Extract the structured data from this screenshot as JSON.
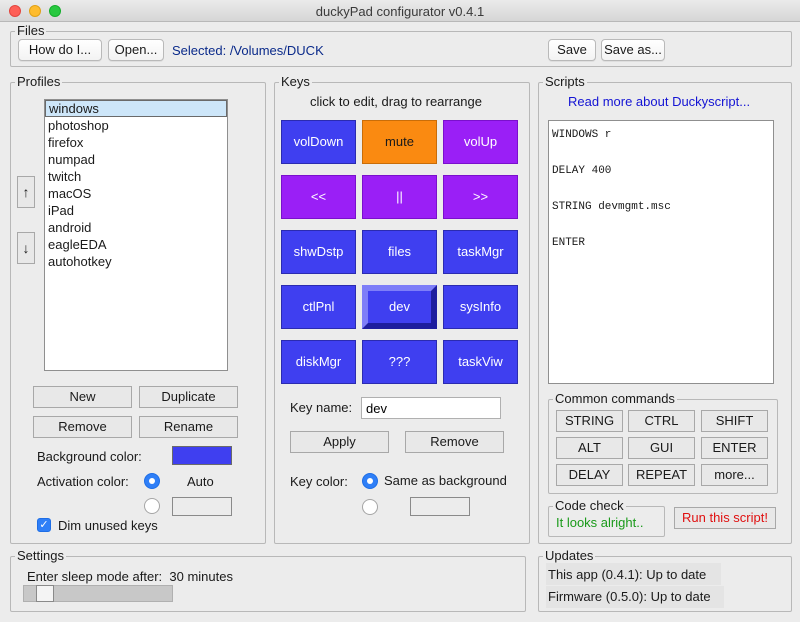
{
  "window": {
    "title": "duckyPad configurator v0.4.1"
  },
  "files": {
    "label": "Files",
    "howdoi_label": "How do I...",
    "open_label": "Open...",
    "selected_text": "Selected: /Volumes/DUCK",
    "save_label": "Save",
    "saveas_label": "Save as..."
  },
  "profiles": {
    "label": "Profiles",
    "items": [
      "windows",
      "photoshop",
      "firefox",
      "numpad",
      "twitch",
      "macOS",
      "iPad",
      "android",
      "eagleEDA",
      "autohotkey"
    ],
    "selected": "windows",
    "up_arrow": "↑",
    "down_arrow": "↓",
    "new_label": "New",
    "duplicate_label": "Duplicate",
    "remove_label": "Remove",
    "rename_label": "Rename",
    "bg_color_label": "Background color:",
    "bg_color": "#3f3ff0",
    "activation_color_label": "Activation color:",
    "auto_label": "Auto",
    "dim_label": "Dim unused keys",
    "dim_checked": true
  },
  "keys": {
    "label": "Keys",
    "hint": "click to edit, drag to rearrange",
    "grid": [
      {
        "label": "volDown",
        "color": "#3f3ff0"
      },
      {
        "label": "mute",
        "color": "#fa8a11"
      },
      {
        "label": "volUp",
        "color": "#9a1ff6"
      },
      {
        "label": "<<",
        "color": "#9a1ff6"
      },
      {
        "label": "||",
        "color": "#9a1ff6"
      },
      {
        "label": ">>",
        "color": "#9a1ff6"
      },
      {
        "label": "shwDstp",
        "color": "#3f3ff0"
      },
      {
        "label": "files",
        "color": "#3f3ff0"
      },
      {
        "label": "taskMgr",
        "color": "#3f3ff0"
      },
      {
        "label": "ctlPnl",
        "color": "#3f3ff0"
      },
      {
        "label": "dev",
        "color": "#3f3ff0"
      },
      {
        "label": "sysInfo",
        "color": "#3f3ff0"
      },
      {
        "label": "diskMgr",
        "color": "#3f3ff0"
      },
      {
        "label": "???",
        "color": "#3f3ff0"
      },
      {
        "label": "taskViw",
        "color": "#3f3ff0"
      }
    ],
    "selected_key": "dev",
    "name_label": "Key name:",
    "name_value": "dev",
    "apply_label": "Apply",
    "remove_label": "Remove",
    "color_label": "Key color:",
    "same_as_bg_label": "Same as background"
  },
  "scripts": {
    "label": "Scripts",
    "link": "Read more about Duckyscript...",
    "lines": [
      "WINDOWS r",
      "",
      "DELAY 400",
      "",
      "STRING devmgmt.msc",
      "",
      "ENTER"
    ],
    "common_label": "Common commands",
    "commands": [
      "STRING",
      "CTRL",
      "SHIFT",
      "ALT",
      "GUI",
      "ENTER",
      "DELAY",
      "REPEAT",
      "more..."
    ],
    "code_check_label": "Code check",
    "code_check_status": "It looks alright..",
    "run_label": "Run this script!"
  },
  "settings": {
    "label": "Settings",
    "sleep_label": "Enter sleep mode after:",
    "sleep_value": "30 minutes",
    "sleep_fraction": 0.08
  },
  "updates": {
    "label": "Updates",
    "app_status": "This app (0.4.1): Up to date",
    "firmware_status": "Firmware (0.5.0): Up to date"
  },
  "colors": {
    "blue_key": "#3f3ff0",
    "purple_key": "#9a1ff6",
    "orange_key": "#fa8a11",
    "selected_text": "#0a2a8a",
    "link": "#1414d4",
    "ok_green": "#1a9a1a",
    "run_red": "#e01010"
  }
}
